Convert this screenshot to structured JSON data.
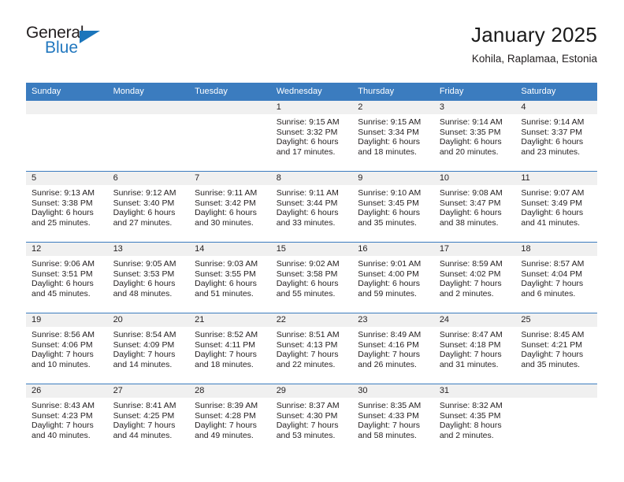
{
  "brand": {
    "name_top": "General",
    "name_bottom": "Blue",
    "accent_color": "#1b75bb"
  },
  "header": {
    "title": "January 2025",
    "subtitle": "Kohila, Raplamaa, Estonia"
  },
  "theme": {
    "header_blue": "#3b7cbf",
    "band_gray": "#f0f0f0",
    "text_color": "#231f20"
  },
  "weekdays": [
    "Sunday",
    "Monday",
    "Tuesday",
    "Wednesday",
    "Thursday",
    "Friday",
    "Saturday"
  ],
  "labels": {
    "sunrise": "Sunrise:",
    "sunset": "Sunset:",
    "daylight": "Daylight:"
  },
  "weeks": [
    [
      {
        "day": "",
        "lines": []
      },
      {
        "day": "",
        "lines": []
      },
      {
        "day": "",
        "lines": []
      },
      {
        "day": "1",
        "lines": [
          "Sunrise: 9:15 AM",
          "Sunset: 3:32 PM",
          "Daylight: 6 hours",
          "and 17 minutes."
        ]
      },
      {
        "day": "2",
        "lines": [
          "Sunrise: 9:15 AM",
          "Sunset: 3:34 PM",
          "Daylight: 6 hours",
          "and 18 minutes."
        ]
      },
      {
        "day": "3",
        "lines": [
          "Sunrise: 9:14 AM",
          "Sunset: 3:35 PM",
          "Daylight: 6 hours",
          "and 20 minutes."
        ]
      },
      {
        "day": "4",
        "lines": [
          "Sunrise: 9:14 AM",
          "Sunset: 3:37 PM",
          "Daylight: 6 hours",
          "and 23 minutes."
        ]
      }
    ],
    [
      {
        "day": "5",
        "lines": [
          "Sunrise: 9:13 AM",
          "Sunset: 3:38 PM",
          "Daylight: 6 hours",
          "and 25 minutes."
        ]
      },
      {
        "day": "6",
        "lines": [
          "Sunrise: 9:12 AM",
          "Sunset: 3:40 PM",
          "Daylight: 6 hours",
          "and 27 minutes."
        ]
      },
      {
        "day": "7",
        "lines": [
          "Sunrise: 9:11 AM",
          "Sunset: 3:42 PM",
          "Daylight: 6 hours",
          "and 30 minutes."
        ]
      },
      {
        "day": "8",
        "lines": [
          "Sunrise: 9:11 AM",
          "Sunset: 3:44 PM",
          "Daylight: 6 hours",
          "and 33 minutes."
        ]
      },
      {
        "day": "9",
        "lines": [
          "Sunrise: 9:10 AM",
          "Sunset: 3:45 PM",
          "Daylight: 6 hours",
          "and 35 minutes."
        ]
      },
      {
        "day": "10",
        "lines": [
          "Sunrise: 9:08 AM",
          "Sunset: 3:47 PM",
          "Daylight: 6 hours",
          "and 38 minutes."
        ]
      },
      {
        "day": "11",
        "lines": [
          "Sunrise: 9:07 AM",
          "Sunset: 3:49 PM",
          "Daylight: 6 hours",
          "and 41 minutes."
        ]
      }
    ],
    [
      {
        "day": "12",
        "lines": [
          "Sunrise: 9:06 AM",
          "Sunset: 3:51 PM",
          "Daylight: 6 hours",
          "and 45 minutes."
        ]
      },
      {
        "day": "13",
        "lines": [
          "Sunrise: 9:05 AM",
          "Sunset: 3:53 PM",
          "Daylight: 6 hours",
          "and 48 minutes."
        ]
      },
      {
        "day": "14",
        "lines": [
          "Sunrise: 9:03 AM",
          "Sunset: 3:55 PM",
          "Daylight: 6 hours",
          "and 51 minutes."
        ]
      },
      {
        "day": "15",
        "lines": [
          "Sunrise: 9:02 AM",
          "Sunset: 3:58 PM",
          "Daylight: 6 hours",
          "and 55 minutes."
        ]
      },
      {
        "day": "16",
        "lines": [
          "Sunrise: 9:01 AM",
          "Sunset: 4:00 PM",
          "Daylight: 6 hours",
          "and 59 minutes."
        ]
      },
      {
        "day": "17",
        "lines": [
          "Sunrise: 8:59 AM",
          "Sunset: 4:02 PM",
          "Daylight: 7 hours",
          "and 2 minutes."
        ]
      },
      {
        "day": "18",
        "lines": [
          "Sunrise: 8:57 AM",
          "Sunset: 4:04 PM",
          "Daylight: 7 hours",
          "and 6 minutes."
        ]
      }
    ],
    [
      {
        "day": "19",
        "lines": [
          "Sunrise: 8:56 AM",
          "Sunset: 4:06 PM",
          "Daylight: 7 hours",
          "and 10 minutes."
        ]
      },
      {
        "day": "20",
        "lines": [
          "Sunrise: 8:54 AM",
          "Sunset: 4:09 PM",
          "Daylight: 7 hours",
          "and 14 minutes."
        ]
      },
      {
        "day": "21",
        "lines": [
          "Sunrise: 8:52 AM",
          "Sunset: 4:11 PM",
          "Daylight: 7 hours",
          "and 18 minutes."
        ]
      },
      {
        "day": "22",
        "lines": [
          "Sunrise: 8:51 AM",
          "Sunset: 4:13 PM",
          "Daylight: 7 hours",
          "and 22 minutes."
        ]
      },
      {
        "day": "23",
        "lines": [
          "Sunrise: 8:49 AM",
          "Sunset: 4:16 PM",
          "Daylight: 7 hours",
          "and 26 minutes."
        ]
      },
      {
        "day": "24",
        "lines": [
          "Sunrise: 8:47 AM",
          "Sunset: 4:18 PM",
          "Daylight: 7 hours",
          "and 31 minutes."
        ]
      },
      {
        "day": "25",
        "lines": [
          "Sunrise: 8:45 AM",
          "Sunset: 4:21 PM",
          "Daylight: 7 hours",
          "and 35 minutes."
        ]
      }
    ],
    [
      {
        "day": "26",
        "lines": [
          "Sunrise: 8:43 AM",
          "Sunset: 4:23 PM",
          "Daylight: 7 hours",
          "and 40 minutes."
        ]
      },
      {
        "day": "27",
        "lines": [
          "Sunrise: 8:41 AM",
          "Sunset: 4:25 PM",
          "Daylight: 7 hours",
          "and 44 minutes."
        ]
      },
      {
        "day": "28",
        "lines": [
          "Sunrise: 8:39 AM",
          "Sunset: 4:28 PM",
          "Daylight: 7 hours",
          "and 49 minutes."
        ]
      },
      {
        "day": "29",
        "lines": [
          "Sunrise: 8:37 AM",
          "Sunset: 4:30 PM",
          "Daylight: 7 hours",
          "and 53 minutes."
        ]
      },
      {
        "day": "30",
        "lines": [
          "Sunrise: 8:35 AM",
          "Sunset: 4:33 PM",
          "Daylight: 7 hours",
          "and 58 minutes."
        ]
      },
      {
        "day": "31",
        "lines": [
          "Sunrise: 8:32 AM",
          "Sunset: 4:35 PM",
          "Daylight: 8 hours",
          "and 2 minutes."
        ]
      },
      {
        "day": "",
        "lines": []
      }
    ]
  ]
}
